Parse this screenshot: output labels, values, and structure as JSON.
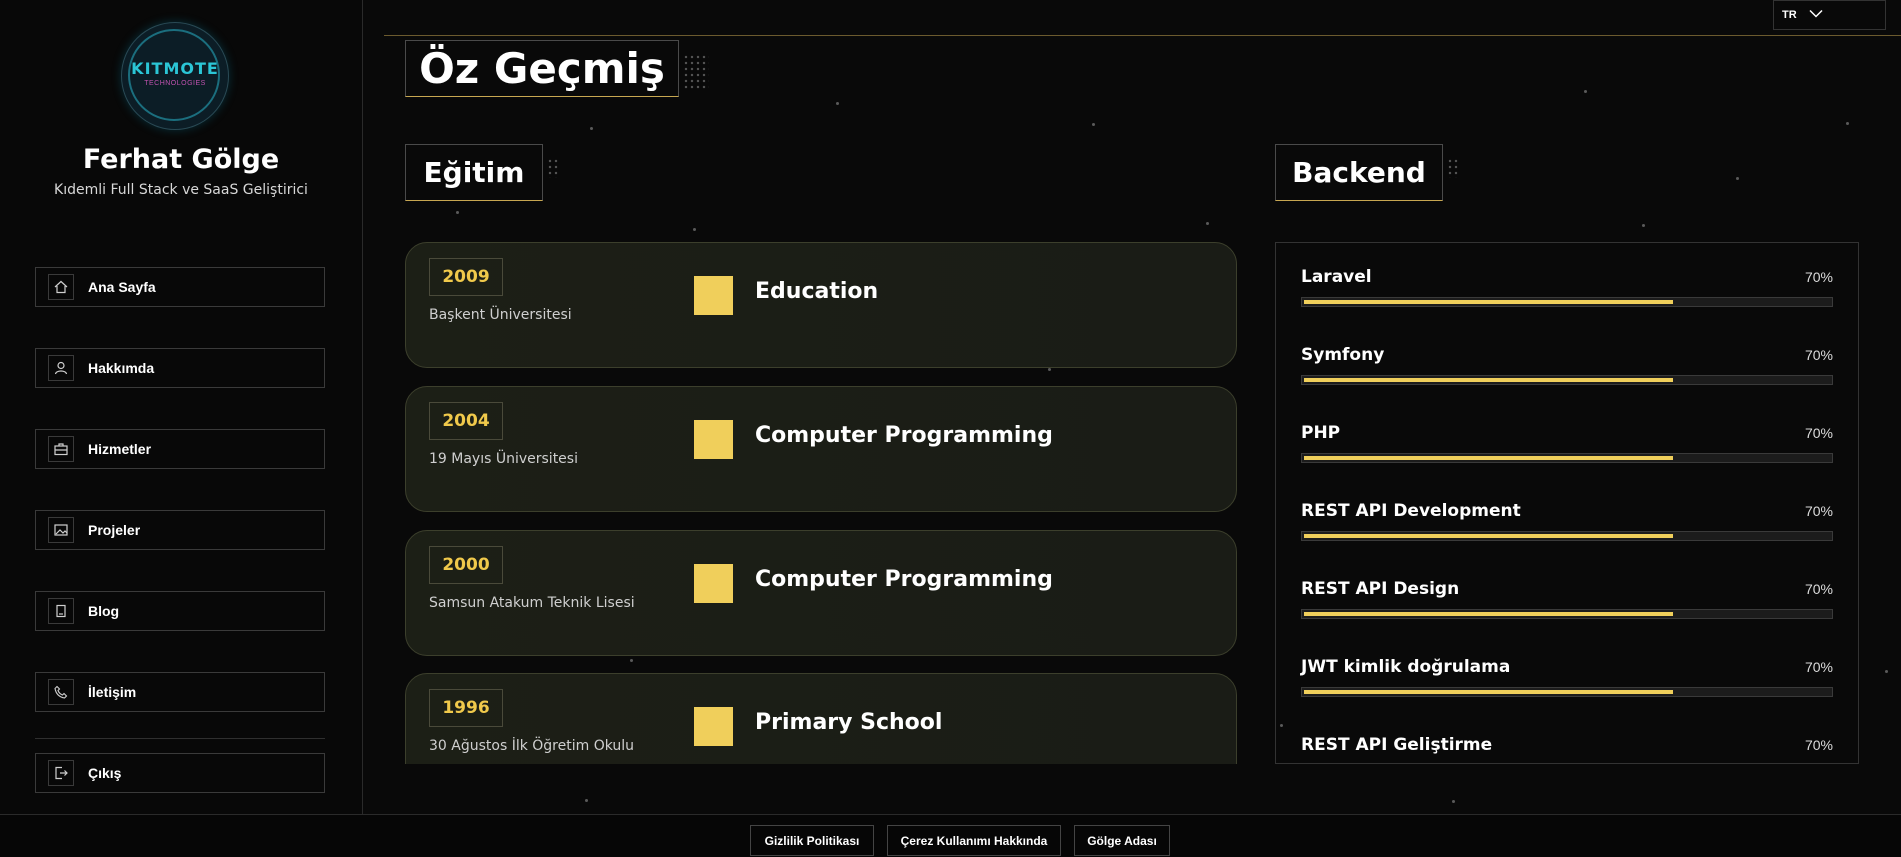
{
  "language": {
    "current": "TR"
  },
  "profile": {
    "logo_text": "KITMOTE",
    "logo_subtext": "TECHNOLOGIES",
    "name": "Ferhat Gölge",
    "role": "Kıdemli Full Stack ve SaaS Geliştirici"
  },
  "nav": {
    "items": [
      {
        "label": "Ana Sayfa",
        "icon": "home-icon"
      },
      {
        "label": "Hakkımda",
        "icon": "user-icon"
      },
      {
        "label": "Hizmetler",
        "icon": "briefcase-icon"
      },
      {
        "label": "Projeler",
        "icon": "image-icon"
      },
      {
        "label": "Blog",
        "icon": "book-icon"
      },
      {
        "label": "İletişim",
        "icon": "phone-icon"
      },
      {
        "label": "Çıkış",
        "icon": "logout-icon"
      }
    ]
  },
  "page": {
    "title": "Öz Geçmiş"
  },
  "education": {
    "title": "Eğitim",
    "items": [
      {
        "year": "2009",
        "school": "Başkent Üniversitesi",
        "degree": "Education"
      },
      {
        "year": "2004",
        "school": "19 Mayıs Üniversitesi",
        "degree": "Computer Programming"
      },
      {
        "year": "2000",
        "school": "Samsun Atakum Teknik Lisesi",
        "degree": "Computer Programming"
      },
      {
        "year": "1996",
        "school": "30 Ağustos İlk Öğretim Okulu",
        "degree": "Primary School"
      }
    ]
  },
  "backend": {
    "title": "Backend",
    "skills": [
      {
        "name": "Laravel",
        "percent_label": "70%",
        "value": 70
      },
      {
        "name": "Symfony",
        "percent_label": "70%",
        "value": 70
      },
      {
        "name": "PHP",
        "percent_label": "70%",
        "value": 70
      },
      {
        "name": "REST API Development",
        "percent_label": "70%",
        "value": 70
      },
      {
        "name": "REST API Design",
        "percent_label": "70%",
        "value": 70
      },
      {
        "name": "JWT kimlik doğrulama",
        "percent_label": "70%",
        "value": 70
      },
      {
        "name": "REST API Geliştirme",
        "percent_label": "70%",
        "value": 70
      }
    ]
  },
  "footer": {
    "links": [
      "Gizlilik Politikası",
      "Çerez Kullanımı Hakkında",
      "Gölge Adası"
    ]
  },
  "colors": {
    "accent": "#f0cf5b",
    "background": "#090909"
  }
}
